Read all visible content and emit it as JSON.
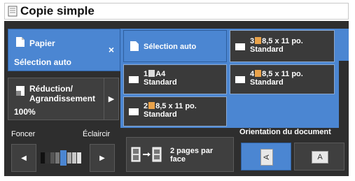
{
  "title": "Copie simple",
  "papier": {
    "label": "Papier",
    "value": "Sélection auto",
    "close": "×"
  },
  "reduction": {
    "label_line1": "Réduction/",
    "label_line2": "Agrandissement",
    "value": "100%",
    "arrow": "▶"
  },
  "paper_options": [
    {
      "line1": "Sélection auto",
      "line2": ""
    },
    {
      "tray": "3",
      "line1": "8,5 x 11 po.",
      "line2": "Standard"
    },
    {
      "tray": "1",
      "line1": "A4",
      "line2": "Standard"
    },
    {
      "tray": "4",
      "line1": "8,5 x 11 po.",
      "line2": "Standard"
    },
    {
      "tray": "2",
      "line1": "8,5 x 11 po.",
      "line2": "Standard"
    }
  ],
  "density": {
    "darker_label": "Foncer",
    "lighter_label": "Éclaircir",
    "darker_arrow": "◀",
    "lighter_arrow": "▶"
  },
  "pages_per_face": {
    "line1": "2 pages par",
    "line2": "face"
  },
  "orientation": {
    "label": "Orientation du document",
    "option_a": "A",
    "option_b": "A"
  }
}
